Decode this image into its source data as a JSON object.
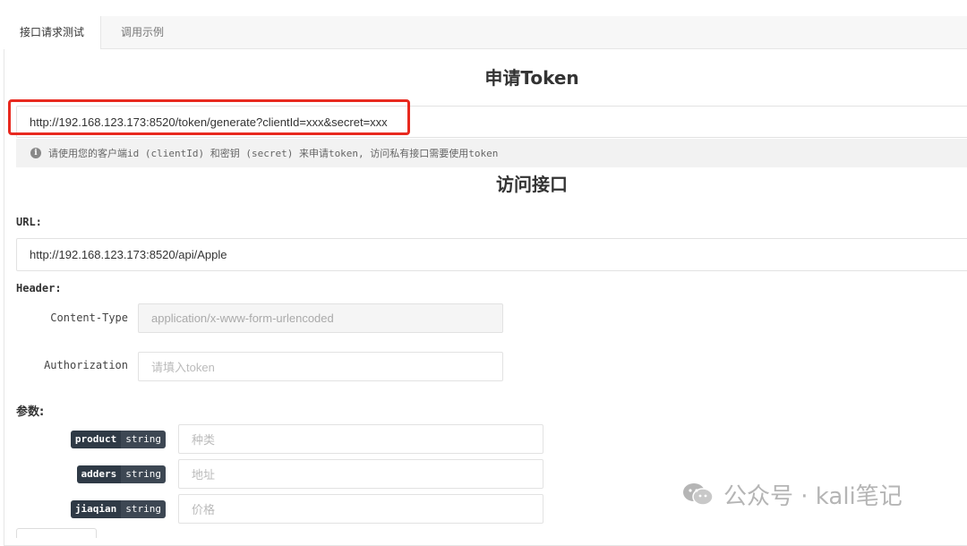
{
  "tabs": [
    {
      "label": "接口请求测试"
    },
    {
      "label": "调用示例"
    }
  ],
  "token_section": {
    "title": "申请Token",
    "url_value": "http://192.168.123.173:8520/token/generate?clientId=xxx&secret=xxx",
    "tip": "请使用您的客户端id (clientId) 和密钥 (secret) 来申请token, 访问私有接口需要使用token"
  },
  "access_section": {
    "title": "访问接口",
    "url_label": "URL:",
    "url_value": "http://192.168.123.173:8520/api/Apple",
    "header_label": "Header:",
    "headers": [
      {
        "key": "Content-Type",
        "value": "application/x-www-form-urlencoded",
        "placeholder": ""
      },
      {
        "key": "Authorization",
        "value": "",
        "placeholder": "请填入token"
      }
    ],
    "params_label": "参数:",
    "params": [
      {
        "name": "product",
        "type": "string",
        "placeholder": "种类"
      },
      {
        "name": "adders",
        "type": "string",
        "placeholder": "地址"
      },
      {
        "name": "jiaqian",
        "type": "string",
        "placeholder": "价格"
      }
    ]
  },
  "watermark": {
    "text": "公众号 · kali笔记",
    "icon": "wechat-icon"
  },
  "colors": {
    "highlight": "#e8291f",
    "badge": "#2f3a46",
    "tip_bg": "#f2f2f2"
  }
}
